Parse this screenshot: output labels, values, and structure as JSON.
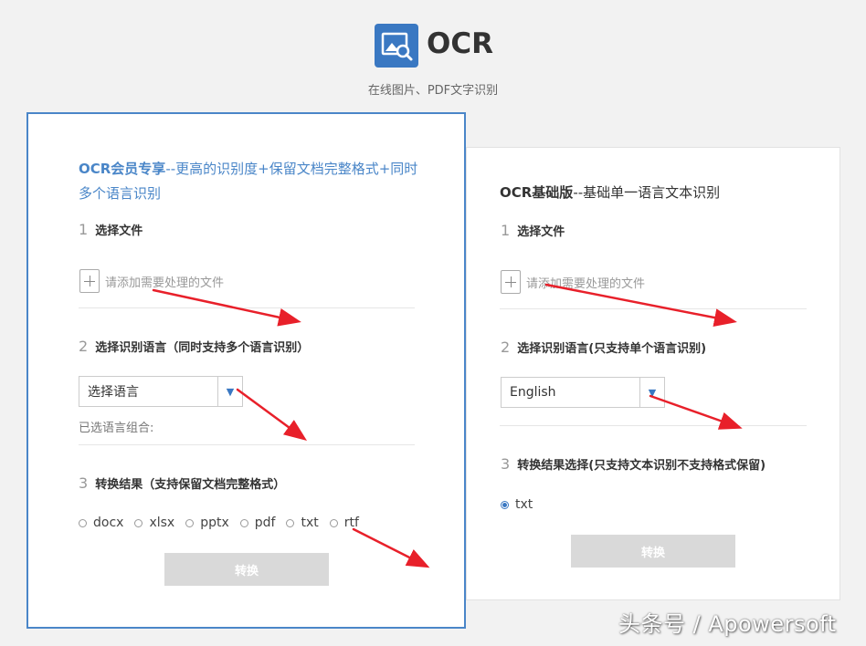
{
  "header": {
    "app_title": "OCR",
    "subtitle": "在线图片、PDF文字识别"
  },
  "member_card": {
    "title_bold": "OCR会员专享",
    "title_rest": "--更高的识别度+保留文档完整格式+同时多个语言识别",
    "step1": {
      "num": "1",
      "label": "选择文件"
    },
    "add_file_placeholder": "请添加需要处理的文件",
    "step2": {
      "num": "2",
      "label": "选择识别语言（同时支持多个语言识别）"
    },
    "language_select": "选择语言",
    "selected_combo_label": "已选语言组合:",
    "step3": {
      "num": "3",
      "label": "转换结果（支持保留文档完整格式）"
    },
    "formats": [
      "docx",
      "xlsx",
      "pptx",
      "pdf",
      "txt",
      "rtf"
    ],
    "convert_button": "转换"
  },
  "basic_card": {
    "title_bold": "OCR基础版",
    "title_rest": "--基础单一语言文本识别",
    "step1": {
      "num": "1",
      "label": "选择文件"
    },
    "add_file_placeholder": "请添加需要处理的文件",
    "step2": {
      "num": "2",
      "label": "选择识别语言(只支持单个语言识别)"
    },
    "language_select": "English",
    "step3": {
      "num": "3",
      "label": "转换结果选择(只支持文本识别不支持格式保留)"
    },
    "formats": [
      "txt"
    ],
    "selected_format": "txt",
    "convert_button": "转换"
  },
  "watermark": "头条号 / Apowersoft",
  "colors": {
    "accent": "#4a86c8",
    "annotation_arrow": "#e8202a",
    "disabled_button": "#d9d9d9"
  }
}
